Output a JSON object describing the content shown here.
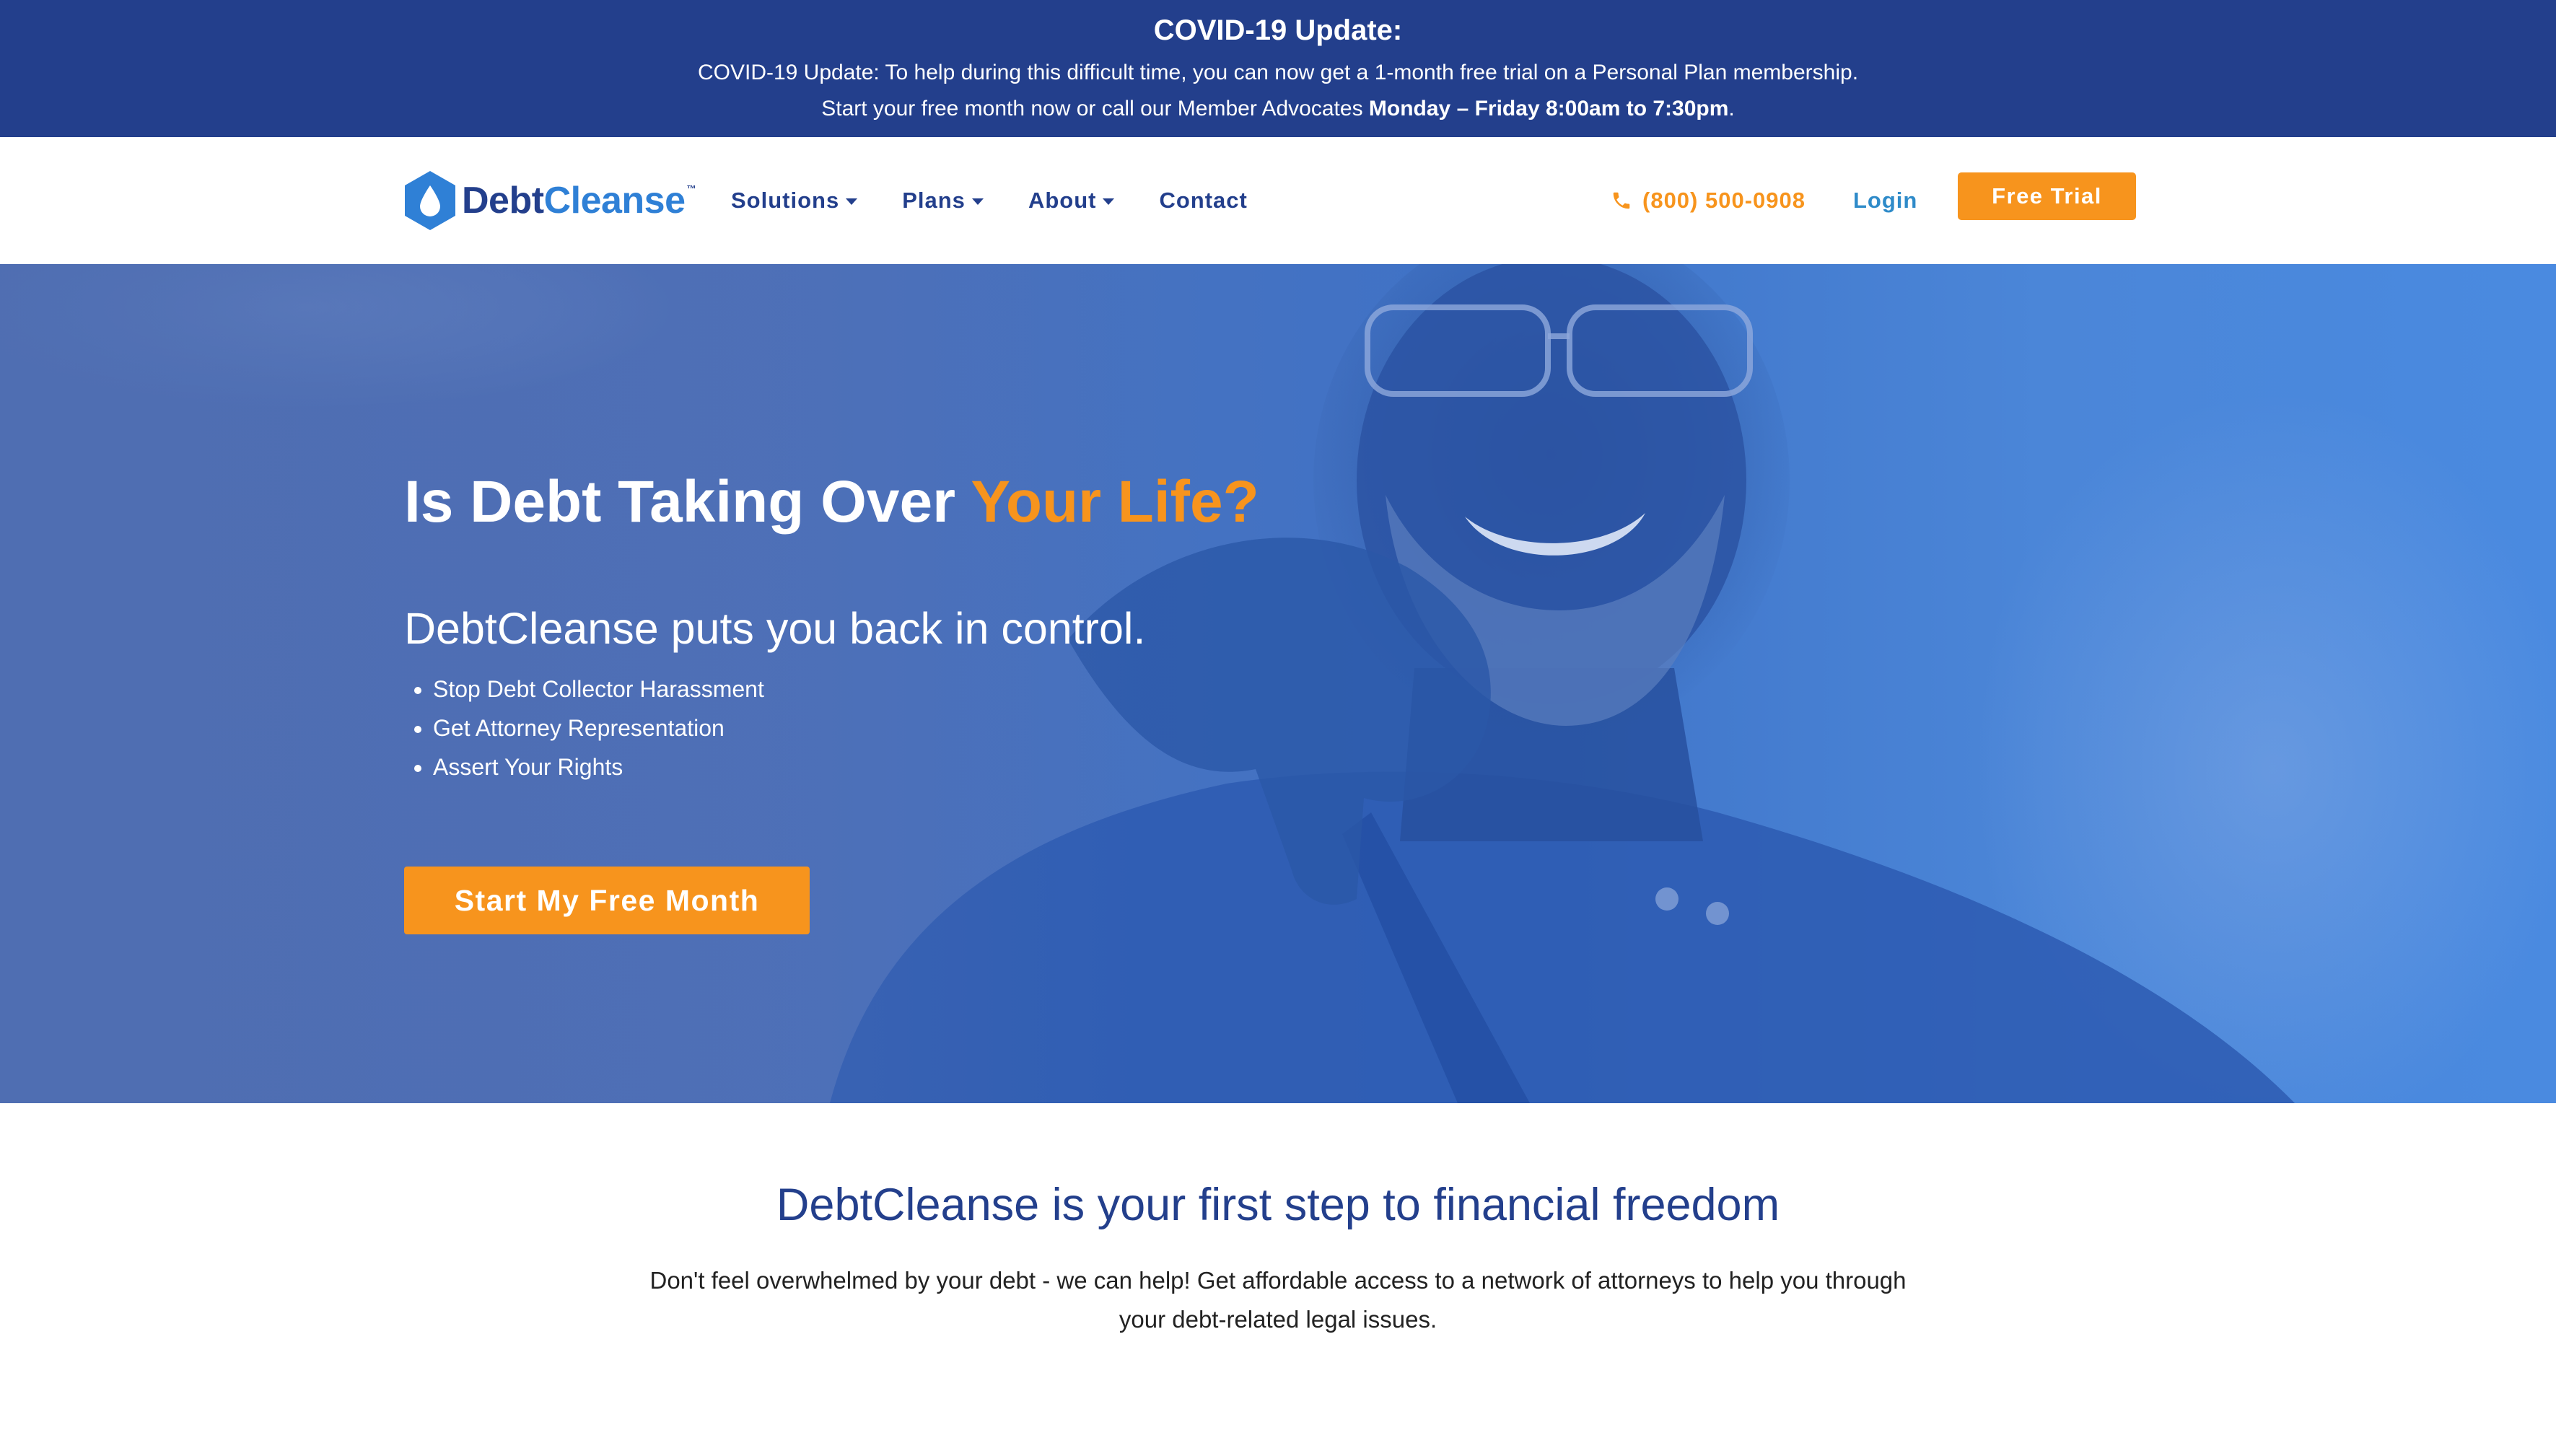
{
  "banner": {
    "title": "COVID-19 Update:",
    "line1": "COVID-19 Update: To help during this difficult time, you can now get a 1-month free trial on a Personal Plan membership.",
    "line2_prefix": "Start your free month now or call our Member Advocates ",
    "line2_bold": "Monday – Friday 8:00am to 7:30pm",
    "line2_suffix": "."
  },
  "header": {
    "logo": {
      "part1": "Debt",
      "part2": "Cleanse",
      "tm": "™"
    },
    "nav": [
      {
        "label": "Solutions",
        "has_dropdown": true
      },
      {
        "label": "Plans",
        "has_dropdown": true
      },
      {
        "label": "About",
        "has_dropdown": true
      },
      {
        "label": "Contact",
        "has_dropdown": false
      }
    ],
    "phone": "(800) 500-0908",
    "login_label": "Login",
    "cta_label": "Free Trial"
  },
  "hero": {
    "title_prefix": "Is Debt Taking Over ",
    "title_accent": "Your Life?",
    "subtitle": "DebtCleanse puts you back in control.",
    "bullets": [
      "Stop Debt Collector Harassment",
      "Get Attorney Representation",
      "Assert Your Rights"
    ],
    "cta_label": "Start My Free Month"
  },
  "intro": {
    "title": "DebtCleanse is your first step to financial freedom",
    "text": "Don't feel overwhelmed by your debt - we can help! Get affordable access to a network of attorneys to help you through your debt-related legal issues."
  },
  "colors": {
    "banner_bg": "#233f8c",
    "nav_text": "#233f8c",
    "logo_accent": "#2f80d6",
    "accent_orange": "#f7941d",
    "login_blue": "#2f8bc9",
    "hero_overlay": "#3f73c7"
  },
  "icons": {
    "logo": "water-drop-hexagon-icon",
    "phone": "phone-icon",
    "dropdown": "caret-down-icon",
    "bullet": "disc-bullet"
  }
}
